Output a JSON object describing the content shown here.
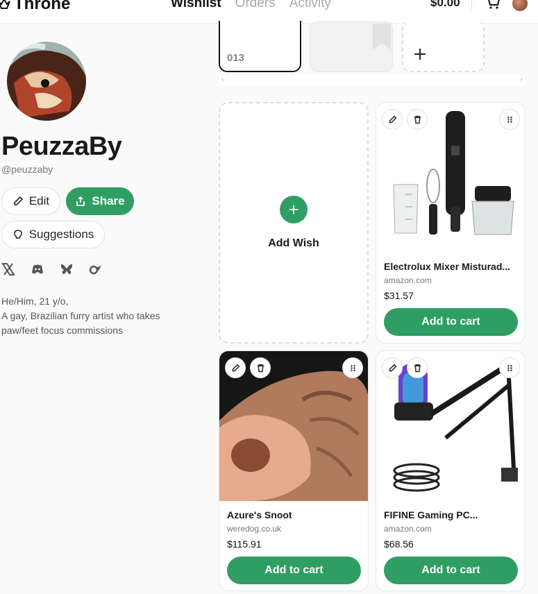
{
  "topbar": {
    "brand": "Throne",
    "nav": [
      "Wishlist",
      "Orders",
      "Activity"
    ],
    "balance": "$0.00"
  },
  "profile": {
    "name": "PeuzzaBy",
    "handle": "@peuzzaby",
    "edit_label": "Edit",
    "share_label": "Share",
    "suggestions_label": "Suggestions",
    "socials": [
      "x-icon",
      "discord-icon",
      "bluesky-icon",
      "link-icon"
    ],
    "bio": [
      "He/Him, 21 y/o,",
      "A gay, Brazilian furry artist who takes",
      "paw/feet focus commissions"
    ]
  },
  "strip": {
    "first_label": "013"
  },
  "addwish": {
    "label": "Add Wish"
  },
  "items": [
    {
      "title": "Electrolux Mixer Misturad...",
      "source": "amazon.com",
      "price": "$31.57",
      "cta": "Add to cart"
    },
    {
      "title": "Azure's Snoot",
      "source": "weredog.co.uk",
      "price": "$115.91",
      "cta": "Add to cart"
    },
    {
      "title": "FIFINE Gaming PC...",
      "source": "amazon.com",
      "price": "$68.56",
      "cta": "Add to cart"
    }
  ],
  "colors": {
    "accent": "#2f9e63"
  }
}
